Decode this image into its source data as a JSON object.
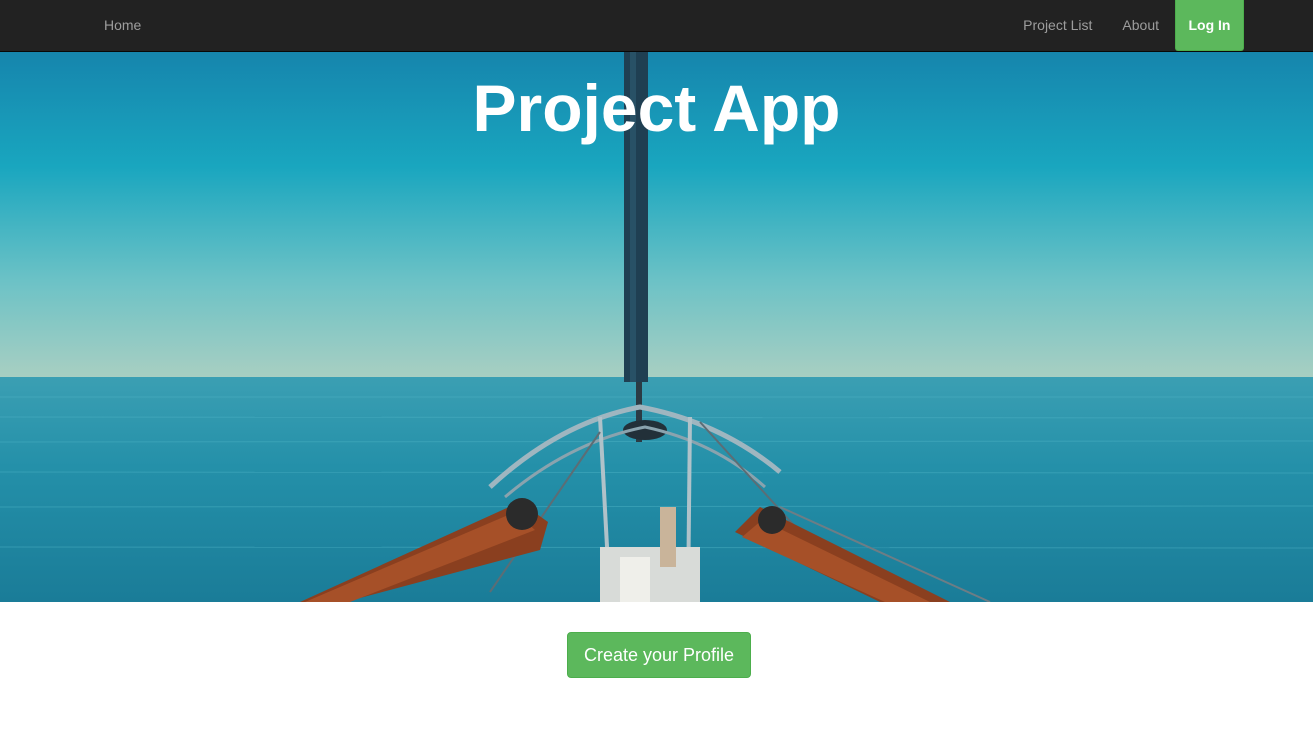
{
  "navbar": {
    "home_label": "Home",
    "links": [
      "Project List",
      "About"
    ],
    "login_label": "Log In"
  },
  "hero": {
    "title": "Project App",
    "image_description_icon": "sailboat-bow-ocean-image"
  },
  "main": {
    "cta_label": "Create your Profile"
  },
  "colors": {
    "navbar_bg": "#222222",
    "nav_text": "#9d9d9d",
    "success": "#5cb85c"
  }
}
